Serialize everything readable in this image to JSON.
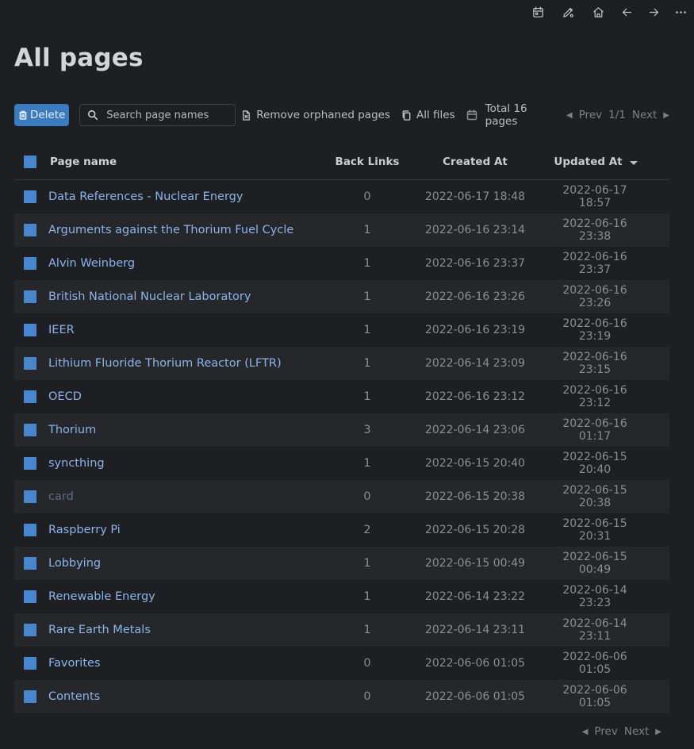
{
  "page": {
    "title": "All pages"
  },
  "toolbar": {
    "delete_label": "Delete",
    "search_placeholder": "Search page names",
    "remove_orphaned_label": "Remove orphaned pages",
    "all_files_label": "All files",
    "total_label": "Total 16 pages",
    "prev_label": "Prev",
    "page_indicator": "1/1",
    "next_label": "Next"
  },
  "table": {
    "columns": {
      "name": "Page name",
      "backlinks": "Back Links",
      "created": "Created At",
      "updated": "Updated At"
    },
    "sort": {
      "column": "updated",
      "direction": "desc"
    },
    "rows": [
      {
        "name": "Data References - Nuclear Energy",
        "backlinks": "0",
        "created": "2022-06-17 18:48",
        "updated": "2022-06-17 18:57",
        "muted": false
      },
      {
        "name": "Arguments against the Thorium Fuel Cycle",
        "backlinks": "1",
        "created": "2022-06-16 23:14",
        "updated": "2022-06-16 23:38",
        "muted": false
      },
      {
        "name": "Alvin Weinberg",
        "backlinks": "1",
        "created": "2022-06-16 23:37",
        "updated": "2022-06-16 23:37",
        "muted": false
      },
      {
        "name": "British National Nuclear Laboratory",
        "backlinks": "1",
        "created": "2022-06-16 23:26",
        "updated": "2022-06-16 23:26",
        "muted": false
      },
      {
        "name": "IEER",
        "backlinks": "1",
        "created": "2022-06-16 23:19",
        "updated": "2022-06-16 23:19",
        "muted": false
      },
      {
        "name": "Lithium Fluoride Thorium Reactor (LFTR)",
        "backlinks": "1",
        "created": "2022-06-14 23:09",
        "updated": "2022-06-16 23:15",
        "muted": false
      },
      {
        "name": "OECD",
        "backlinks": "1",
        "created": "2022-06-16 23:12",
        "updated": "2022-06-16 23:12",
        "muted": false
      },
      {
        "name": "Thorium",
        "backlinks": "3",
        "created": "2022-06-14 23:06",
        "updated": "2022-06-16 01:17",
        "muted": false
      },
      {
        "name": "syncthing",
        "backlinks": "1",
        "created": "2022-06-15 20:40",
        "updated": "2022-06-15 20:40",
        "muted": false
      },
      {
        "name": "card",
        "backlinks": "0",
        "created": "2022-06-15 20:38",
        "updated": "2022-06-15 20:38",
        "muted": true
      },
      {
        "name": "Raspberry Pi",
        "backlinks": "2",
        "created": "2022-06-15 20:28",
        "updated": "2022-06-15 20:31",
        "muted": false
      },
      {
        "name": "Lobbying",
        "backlinks": "1",
        "created": "2022-06-15 00:49",
        "updated": "2022-06-15 00:49",
        "muted": false
      },
      {
        "name": "Renewable Energy",
        "backlinks": "1",
        "created": "2022-06-14 23:22",
        "updated": "2022-06-14 23:23",
        "muted": false
      },
      {
        "name": "Rare Earth Metals",
        "backlinks": "1",
        "created": "2022-06-14 23:11",
        "updated": "2022-06-14 23:11",
        "muted": false
      },
      {
        "name": "Favorites",
        "backlinks": "0",
        "created": "2022-06-06 01:05",
        "updated": "2022-06-06 01:05",
        "muted": false
      },
      {
        "name": "Contents",
        "backlinks": "0",
        "created": "2022-06-06 01:05",
        "updated": "2022-06-06 01:05",
        "muted": false
      }
    ]
  },
  "footer": {
    "prev_label": "Prev",
    "next_label": "Next"
  },
  "icons": {
    "topbar": [
      "calendar-icon",
      "pencil-icon",
      "home-icon",
      "arrow-left-icon",
      "arrow-right-icon",
      "more-icon"
    ]
  },
  "colors": {
    "accent": "#3b7bbf",
    "link": "#8bb4ec",
    "checkbox": "#4a85d0",
    "background": "#1e1f22"
  }
}
